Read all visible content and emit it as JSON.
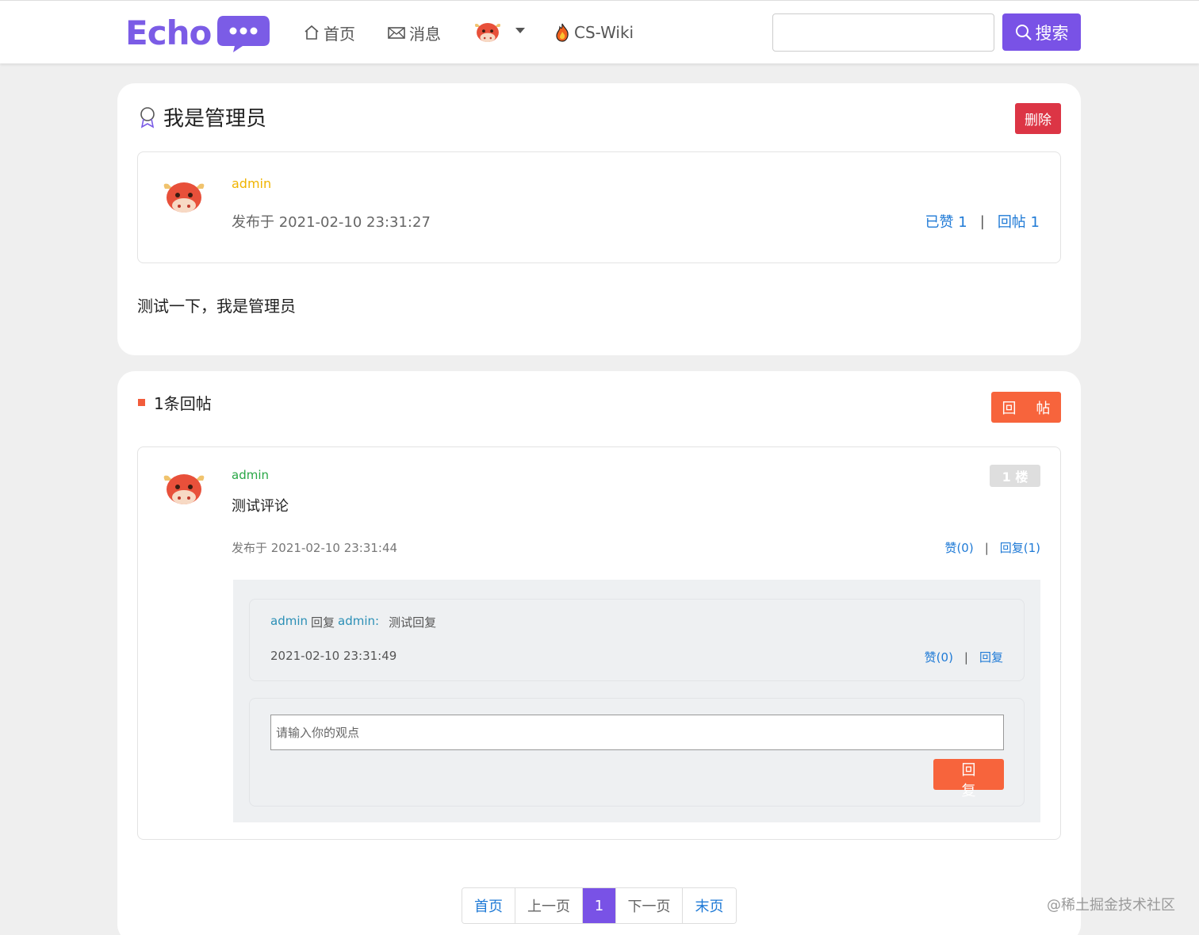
{
  "header": {
    "logo_text": "Echo",
    "nav": {
      "home": "首页",
      "messages": "消息",
      "wiki": "CS-Wiki"
    },
    "search": {
      "value": "",
      "placeholder": "",
      "button_label": "搜索"
    },
    "accent_color": "#7952e6"
  },
  "post": {
    "title": "我是管理员",
    "delete_label": "删除",
    "author": "admin",
    "published": "发布于 2021-02-10 23:31:27",
    "liked_label": "已赞 1",
    "reply_count_label": "回帖 1",
    "content": "测试一下，我是管理员"
  },
  "replies": {
    "header": "1条回帖",
    "reply_button": "回  帖",
    "items": [
      {
        "author": "admin",
        "floor": "1 楼",
        "text": "测试评论",
        "published": "发布于 2021-02-10 23:31:44",
        "like_label": "赞(0)",
        "reply_label": "回复(1)",
        "sub_replies": [
          {
            "user": "admin",
            "verb": "回复",
            "target": "admin:",
            "text": "测试回复",
            "time": "2021-02-10 23:31:49",
            "like_label": "赞(0)",
            "reply_label": "回复"
          }
        ],
        "form": {
          "placeholder": "请输入你的观点",
          "submit_label": "回  复"
        }
      }
    ]
  },
  "pagination": {
    "first": "首页",
    "prev": "上一页",
    "current": "1",
    "next": "下一页",
    "last": "末页"
  },
  "watermark": "@稀土掘金技术社区"
}
